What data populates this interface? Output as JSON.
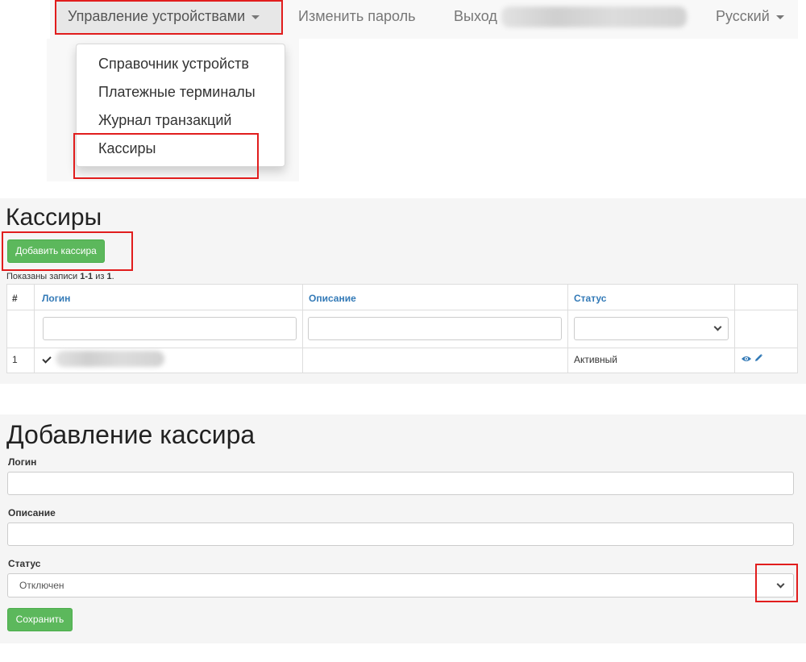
{
  "navbar": {
    "device_mgmt_label": "Управление устройствами",
    "change_password_label": "Изменить пароль",
    "logout_label": "Выход",
    "language_label": "Русский"
  },
  "dropdown": {
    "items": [
      {
        "label": "Справочник устройств"
      },
      {
        "label": "Платежные терминалы"
      },
      {
        "label": "Журнал транзакций"
      },
      {
        "label": "Кассиры"
      }
    ]
  },
  "cashiers": {
    "title": "Кассиры",
    "add_button_label": "Добавить кассира",
    "summary": {
      "prefix": "Показаны записи ",
      "range": "1-1",
      "middle": " из ",
      "total": "1",
      "suffix": "."
    },
    "columns": {
      "num": "#",
      "login": "Логин",
      "description": "Описание",
      "status": "Статус"
    },
    "rows": [
      {
        "num": "1",
        "status": "Активный"
      }
    ]
  },
  "add_cashier": {
    "title": "Добавление кассира",
    "login_label": "Логин",
    "description_label": "Описание",
    "status_label": "Статус",
    "status_value": "Отключен",
    "save_label": "Сохранить"
  },
  "colors": {
    "highlight": "#e11d1d",
    "success": "#5cb85c",
    "link": "#337ab7"
  }
}
